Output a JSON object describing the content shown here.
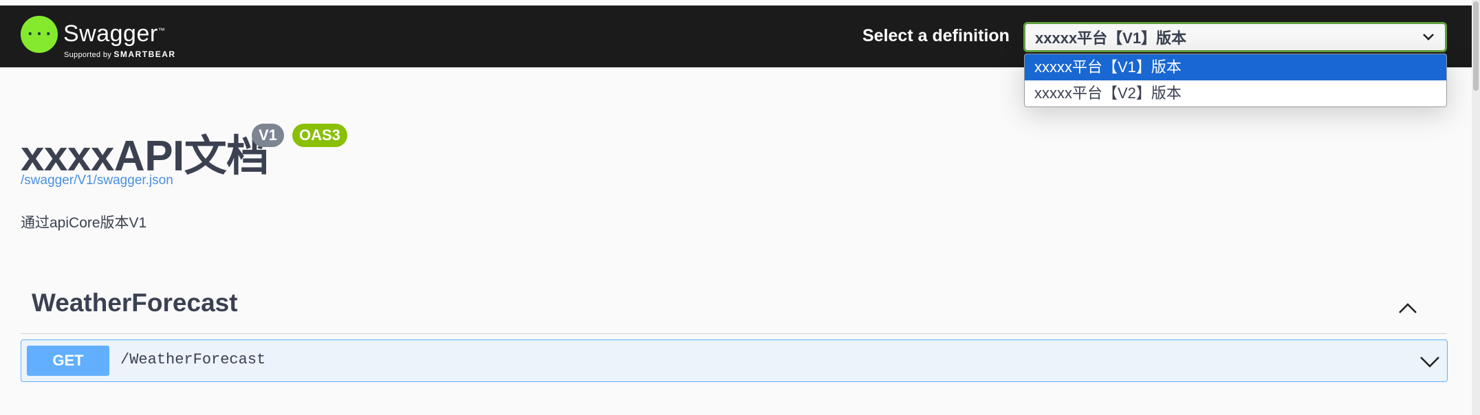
{
  "topbar": {
    "logo_text": "Swagger",
    "logo_tm": "™",
    "logo_sub_prefix": "Supported by ",
    "logo_sub_brand": "SMARTBEAR",
    "definition_label": "Select a definition",
    "definition_selected": "xxxxx平台【V1】版本",
    "definition_options": [
      "xxxxx平台【V1】版本",
      "xxxxx平台【V2】版本"
    ]
  },
  "info": {
    "title": "xxxxAPI文档",
    "version_badge": "V1",
    "oas_badge": "OAS3",
    "spec_url": "/swagger/V1/swagger.json",
    "description": "通过apiCore版本V1"
  },
  "tag": {
    "name": "WeatherForecast",
    "operation": {
      "method": "GET",
      "path": "/WeatherForecast"
    }
  },
  "colors": {
    "topbar_bg": "#1b1b1b",
    "logo_green": "#85ea2d",
    "select_border": "#62a03f",
    "get_blue": "#61affe",
    "option_selected": "#1967d2",
    "oas_green": "#89bf04"
  }
}
